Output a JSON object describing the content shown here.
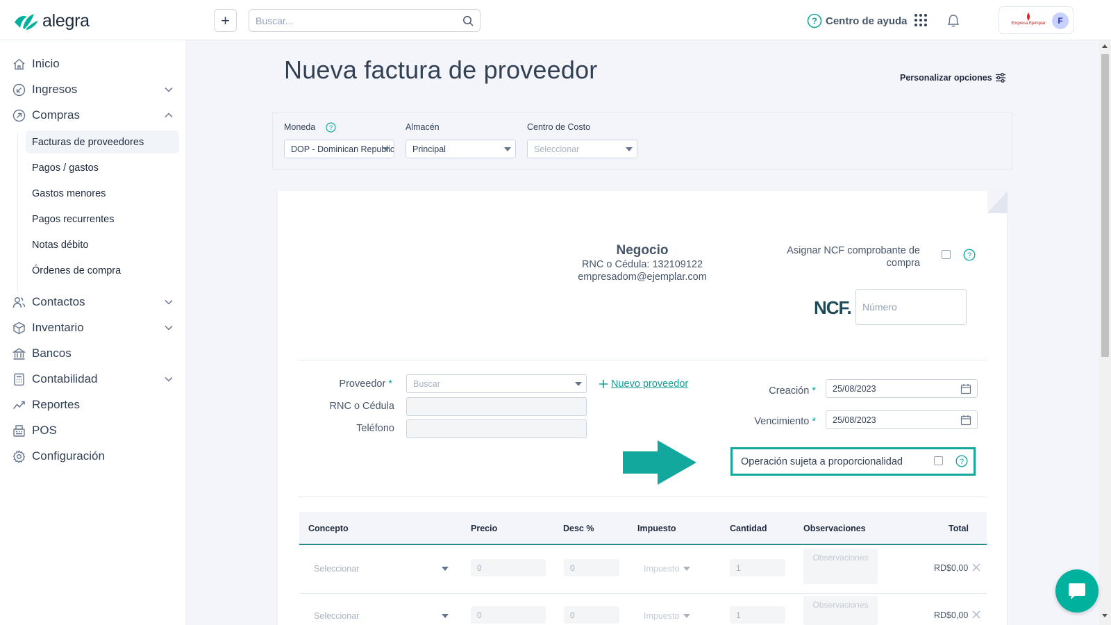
{
  "brand": {
    "name": "alegra"
  },
  "topbar": {
    "search_placeholder": "Buscar...",
    "help_label": "Centro de ayuda",
    "company_logo_text": "Empresa Ejemplar",
    "avatar_initial": "F"
  },
  "sidebar": {
    "items": [
      {
        "label": "Inicio",
        "icon": "home-icon"
      },
      {
        "label": "Ingresos",
        "icon": "income-icon",
        "expandable": true
      },
      {
        "label": "Compras",
        "icon": "purchases-icon",
        "expanded": true
      },
      {
        "label": "Contactos",
        "icon": "contacts-icon",
        "expandable": true
      },
      {
        "label": "Inventario",
        "icon": "inventory-icon",
        "expandable": true
      },
      {
        "label": "Bancos",
        "icon": "bank-icon"
      },
      {
        "label": "Contabilidad",
        "icon": "accounting-icon",
        "expandable": true
      },
      {
        "label": "Reportes",
        "icon": "reports-icon"
      },
      {
        "label": "POS",
        "icon": "pos-icon"
      },
      {
        "label": "Configuración",
        "icon": "settings-icon"
      }
    ],
    "compras_sub": [
      {
        "label": "Facturas de proveedores",
        "active": true
      },
      {
        "label": "Pagos / gastos"
      },
      {
        "label": "Gastos menores"
      },
      {
        "label": "Pagos recurrentes"
      },
      {
        "label": "Notas débito"
      },
      {
        "label": "Órdenes de compra"
      }
    ]
  },
  "page": {
    "title": "Nueva factura de proveedor",
    "customize_label": "Personalizar opciones"
  },
  "settings": {
    "currency_label": "Moneda",
    "currency_value": "DOP - Dominican Republic",
    "warehouse_label": "Almacén",
    "warehouse_value": "Principal",
    "cost_center_label": "Centro de Costo",
    "cost_center_placeholder": "Seleccionar"
  },
  "business": {
    "name": "Negocio",
    "rnc": "RNC o Cédula: 132109122",
    "email": "empresadom@ejemplar.com"
  },
  "ncf": {
    "assign_label": "Asignar NCF comprobante de compra",
    "label": "NCF.",
    "number_placeholder": "Número"
  },
  "form": {
    "provider_label": "Proveedor",
    "provider_placeholder": "Buscar",
    "new_provider_label": "Nuevo proveedor",
    "rnc_label": "RNC o Cédula",
    "phone_label": "Teléfono",
    "created_label": "Creación",
    "created_value": "25/08/2023",
    "due_label": "Vencimiento",
    "due_value": "25/08/2023",
    "required_mark": "*",
    "proportionality_label": "Operación sujeta a proporcionalidad"
  },
  "table": {
    "columns": [
      "Concepto",
      "Precio",
      "Desc %",
      "Impuesto",
      "Cantidad",
      "Observaciones",
      "Total"
    ],
    "rows": [
      {
        "concept": "Seleccionar",
        "price": "0",
        "discount": "0",
        "tax": "Impuesto",
        "quantity": "1",
        "notes": "Observaciones",
        "total": "RD$0,00"
      },
      {
        "concept": "Seleccionar",
        "price": "0",
        "discount": "0",
        "tax": "Impuesto",
        "quantity": "1",
        "notes": "Observaciones",
        "total": "RD$0,00"
      }
    ]
  },
  "colors": {
    "accent": "#13a89e",
    "brand": "#00b19d",
    "header_underline": "#1f8a8a"
  }
}
